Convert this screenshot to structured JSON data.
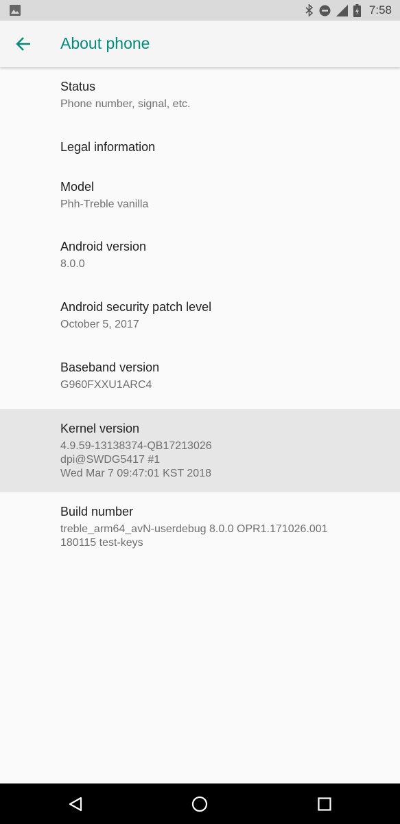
{
  "status_bar": {
    "time": "7:58",
    "icons": [
      "image-icon",
      "bluetooth-icon",
      "do-not-disturb-icon",
      "signal-icon",
      "battery-icon"
    ]
  },
  "app_bar": {
    "title": "About phone",
    "back_icon": "arrow-back-icon",
    "accent_color": "#00897b"
  },
  "items": [
    {
      "title": "Status",
      "summary": [
        "Phone number, signal, etc."
      ]
    },
    {
      "title": "Legal information",
      "summary": []
    },
    {
      "title": "Model",
      "summary": [
        "Phh-Treble vanilla"
      ]
    },
    {
      "title": "Android version",
      "summary": [
        "8.0.0"
      ]
    },
    {
      "title": "Android security patch level",
      "summary": [
        "October 5, 2017"
      ]
    },
    {
      "title": "Baseband version",
      "summary": [
        "G960FXXU1ARC4"
      ]
    },
    {
      "title": "Kernel version",
      "summary": [
        "4.9.59-13138374-QB17213026",
        "dpi@SWDG5417 #1",
        "Wed Mar 7 09:47:01 KST 2018"
      ]
    },
    {
      "title": "Build number",
      "summary": [
        "treble_arm64_avN-userdebug 8.0.0 OPR1.171026.001",
        "180115 test-keys"
      ]
    }
  ],
  "nav_bar": {
    "icons": [
      "back-triangle-icon",
      "home-circle-icon",
      "recents-square-icon"
    ]
  }
}
